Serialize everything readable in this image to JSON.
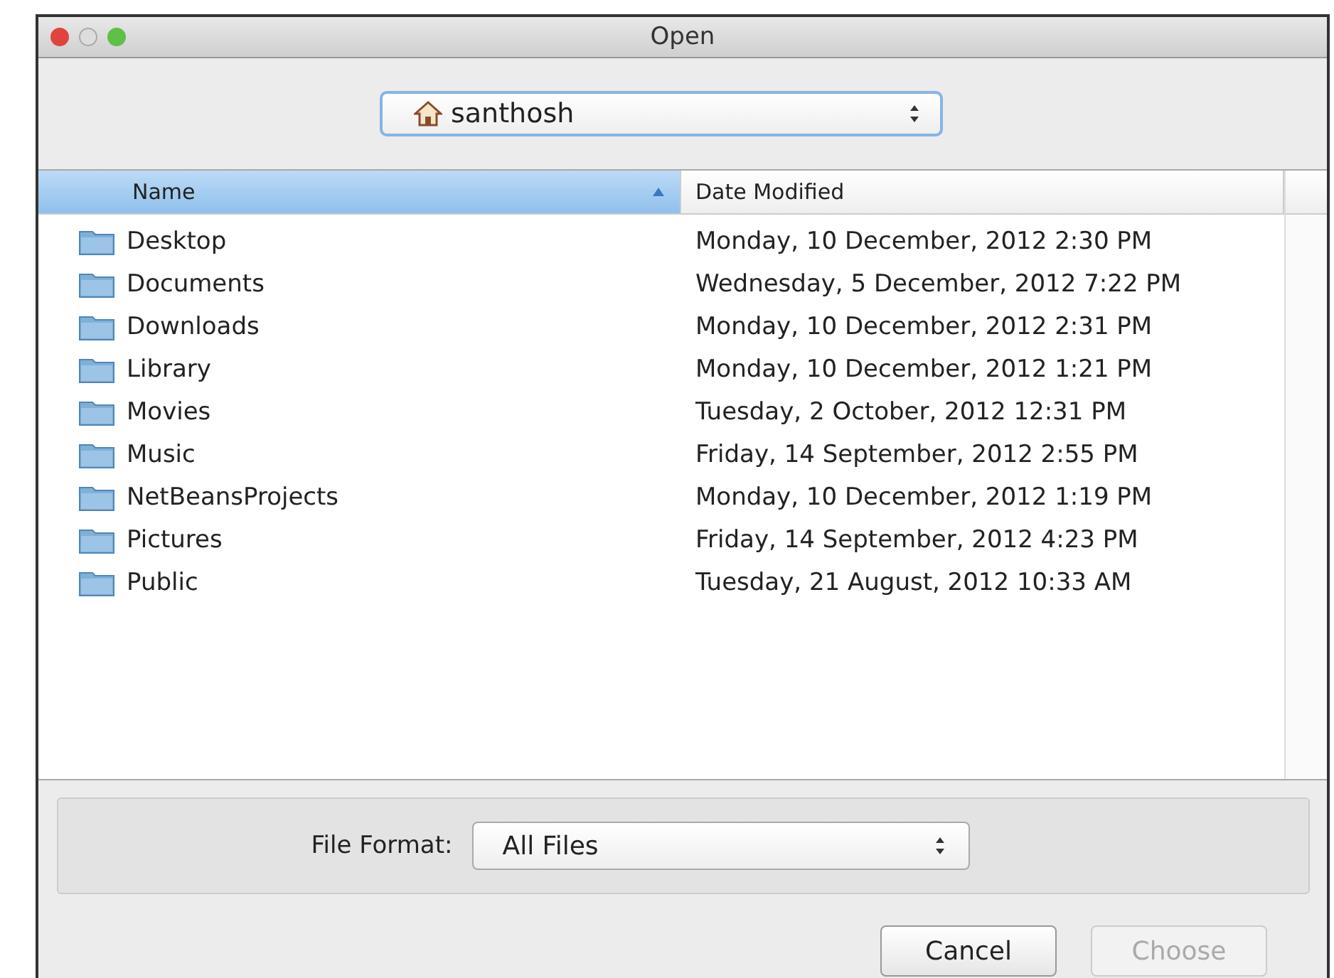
{
  "window": {
    "title": "Open"
  },
  "location": {
    "value": "santhosh"
  },
  "table": {
    "columns": [
      {
        "label": "Name",
        "sorted": true
      },
      {
        "label": "Date Modified",
        "sorted": false
      }
    ],
    "rows": [
      {
        "name": "Desktop",
        "date": "Monday, 10 December, 2012 2:30 PM"
      },
      {
        "name": "Documents",
        "date": "Wednesday, 5 December, 2012 7:22 PM"
      },
      {
        "name": "Downloads",
        "date": "Monday, 10 December, 2012 2:31 PM"
      },
      {
        "name": "Library",
        "date": "Monday, 10 December, 2012 1:21 PM"
      },
      {
        "name": "Movies",
        "date": "Tuesday, 2 October, 2012 12:31 PM"
      },
      {
        "name": "Music",
        "date": "Friday, 14 September, 2012 2:55 PM"
      },
      {
        "name": "NetBeansProjects",
        "date": "Monday, 10 December, 2012 1:19 PM"
      },
      {
        "name": "Pictures",
        "date": "Friday, 14 September, 2012 4:23 PM"
      },
      {
        "name": "Public",
        "date": "Tuesday, 21 August, 2012 10:33 AM"
      }
    ]
  },
  "file_format": {
    "label": "File Format:",
    "value": "All Files"
  },
  "buttons": [
    {
      "label": "Cancel",
      "disabled": false
    },
    {
      "label": "Choose",
      "disabled": true
    }
  ]
}
